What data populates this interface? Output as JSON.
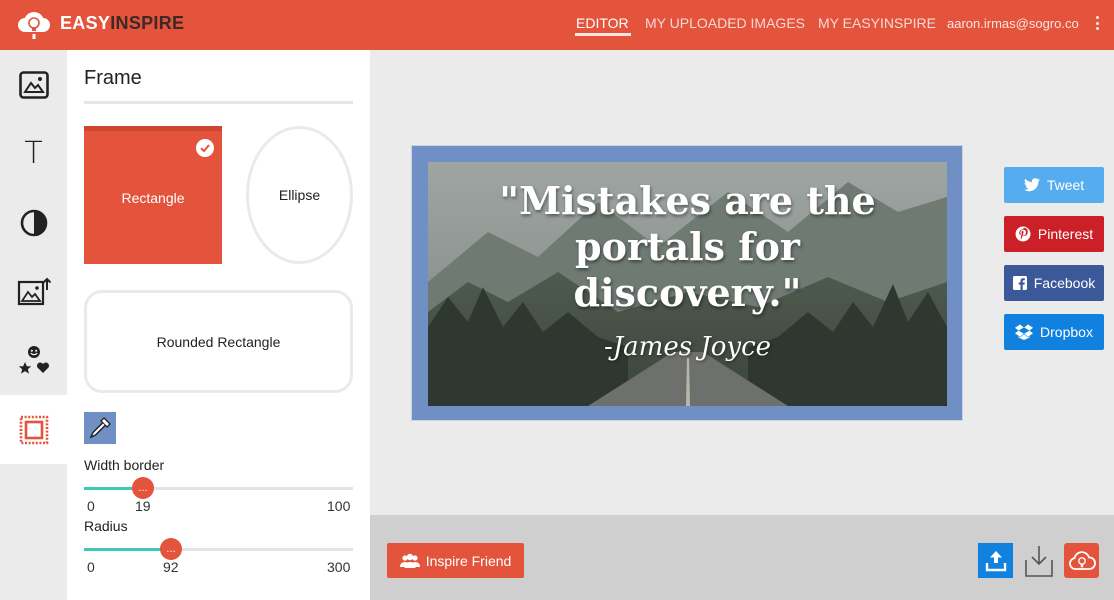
{
  "header": {
    "brand_primary": "EASY",
    "brand_secondary": "INSPIRE",
    "nav": [
      {
        "label": "EDITOR",
        "active": true
      },
      {
        "label": "MY UPLOADED IMAGES",
        "active": false
      },
      {
        "label": "MY EASYINSPIRE",
        "active": false
      }
    ],
    "user_email": "aaron.irmas@sogro.co",
    "color": "#e4533b"
  },
  "tools": [
    {
      "icon": "image-icon",
      "active": false
    },
    {
      "icon": "text-icon",
      "label": "T",
      "active": false
    },
    {
      "icon": "contrast-icon",
      "active": false
    },
    {
      "icon": "upload-image-icon",
      "active": false
    },
    {
      "icon": "stickers-icon",
      "active": false
    },
    {
      "icon": "frame-icon",
      "active": true
    }
  ],
  "panel": {
    "title": "Frame",
    "shapes": [
      {
        "label": "Rectangle",
        "selected": true
      },
      {
        "label": "Ellipse",
        "selected": false
      },
      {
        "label": "Rounded Rectangle",
        "selected": false
      }
    ],
    "border_color": "#6f8fc5",
    "width_border": {
      "label": "Width border",
      "min": "0",
      "value": "19",
      "max": "100",
      "thumb_text": "..."
    },
    "radius": {
      "label": "Radius",
      "min": "0",
      "value": "92",
      "max": "300",
      "thumb_text": "..."
    }
  },
  "canvas": {
    "quote_lines": [
      "\"Mistakes are the",
      "portals for",
      "discovery.\""
    ],
    "author": "-James Joyce"
  },
  "share": {
    "tweet": "Tweet",
    "pinterest": "Pinterest",
    "facebook": "Facebook",
    "dropbox": "Dropbox"
  },
  "bottom": {
    "inspire_friend": "Inspire Friend"
  },
  "colors": {
    "accent": "#e4533b",
    "slider_fill": "#3ec9b4",
    "twitter": "#55acee",
    "pinterest": "#cb2027",
    "facebook": "#3b5998",
    "dropbox": "#1081de"
  }
}
